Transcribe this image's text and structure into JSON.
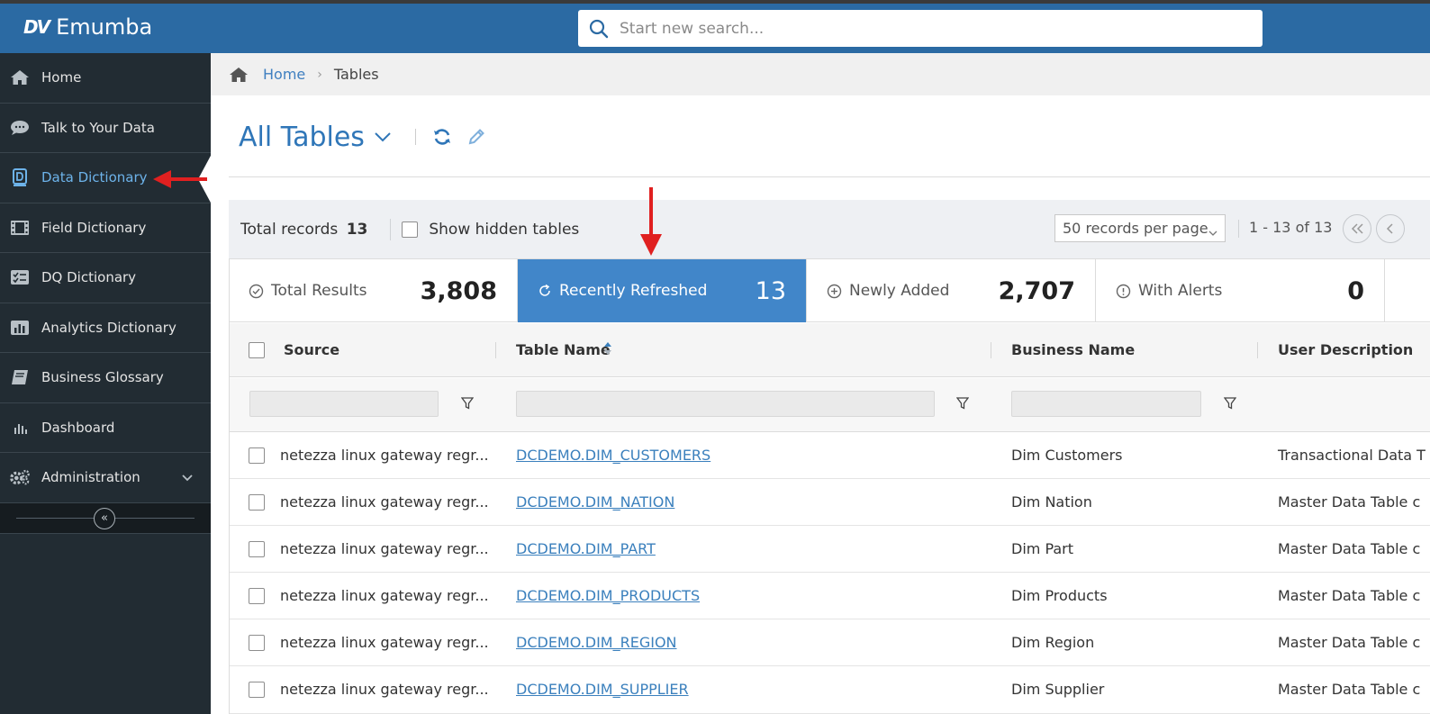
{
  "app": {
    "brand_mark": "DV",
    "brand_name": "Emumba"
  },
  "search": {
    "placeholder": "Start new search..."
  },
  "sidebar": {
    "items": [
      {
        "label": "Home",
        "icon": "home-icon"
      },
      {
        "label": "Talk to Your Data",
        "icon": "chat-icon"
      },
      {
        "label": "Data Dictionary",
        "icon": "dictionary-icon",
        "active": true
      },
      {
        "label": "Field Dictionary",
        "icon": "film-grid-icon"
      },
      {
        "label": "DQ Dictionary",
        "icon": "checklist-icon"
      },
      {
        "label": "Analytics Dictionary",
        "icon": "bar-chart-icon"
      },
      {
        "label": "Business Glossary",
        "icon": "book-icon"
      },
      {
        "label": "Dashboard",
        "icon": "dashboard-icon"
      },
      {
        "label": "Administration",
        "icon": "gears-icon"
      }
    ],
    "collapse_glyph": "«"
  },
  "breadcrumb": {
    "home": "Home",
    "separator": "›",
    "current": "Tables"
  },
  "page": {
    "title": "All Tables"
  },
  "toolbar": {
    "total_label": "Total records",
    "total_value": "13",
    "show_hidden_label": "Show hidden tables",
    "per_page": "50 records per page",
    "page_range": "1 - 13 of 13"
  },
  "stats": [
    {
      "label": "Total Results",
      "value": "3,808"
    },
    {
      "label": "Recently Refreshed",
      "value": "13",
      "active": true
    },
    {
      "label": "Newly Added",
      "value": "2,707"
    },
    {
      "label": "With Alerts",
      "value": "0"
    }
  ],
  "table": {
    "columns": [
      "Source",
      "Table Name",
      "Business Name",
      "User Description"
    ],
    "rows": [
      {
        "source": "netezza linux gateway regr...",
        "table_name": "DCDEMO.DIM_CUSTOMERS",
        "business_name": "Dim Customers",
        "user_description": "Transactional Data T"
      },
      {
        "source": "netezza linux gateway regr...",
        "table_name": "DCDEMO.DIM_NATION",
        "business_name": "Dim Nation",
        "user_description": "Master Data Table c"
      },
      {
        "source": "netezza linux gateway regr...",
        "table_name": "DCDEMO.DIM_PART",
        "business_name": "Dim Part",
        "user_description": "Master Data Table c"
      },
      {
        "source": "netezza linux gateway regr...",
        "table_name": "DCDEMO.DIM_PRODUCTS",
        "business_name": "Dim Products",
        "user_description": "Master Data Table c"
      },
      {
        "source": "netezza linux gateway regr...",
        "table_name": "DCDEMO.DIM_REGION",
        "business_name": "Dim Region",
        "user_description": "Master Data Table c"
      },
      {
        "source": "netezza linux gateway regr...",
        "table_name": "DCDEMO.DIM_SUPPLIER",
        "business_name": "Dim Supplier",
        "user_description": "Master Data Table c"
      }
    ]
  },
  "colors": {
    "topbar": "#2b6aa3",
    "sidebar": "#222c33",
    "active_nav": "#6db3ea",
    "active_stat": "#4186c9",
    "link": "#3b80bd",
    "annotation_arrow": "#e02020"
  }
}
